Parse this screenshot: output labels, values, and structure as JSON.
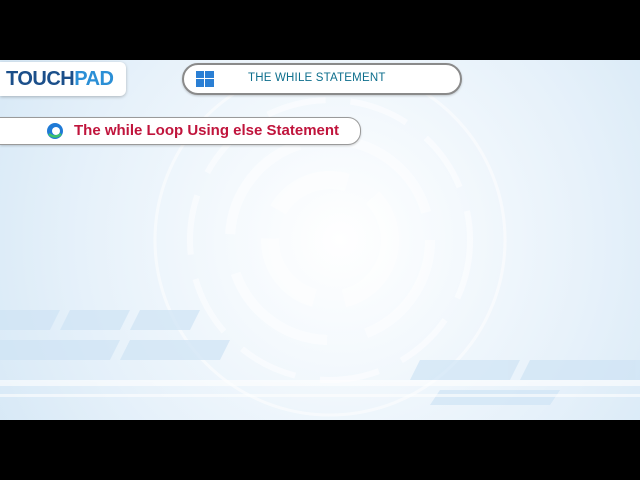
{
  "brand": {
    "logo_part1": "TOUCH",
    "logo_part2": "PAD"
  },
  "header": {
    "title": "THE WHILE STATEMENT",
    "icon": "windows-icon"
  },
  "subheader": {
    "title": "The while Loop Using else Statement",
    "icon": "edge-browser-icon"
  },
  "colors": {
    "title_color": "#0d6e8c",
    "subtitle_color": "#c0143c",
    "logo_dark": "#1b4f8a",
    "logo_light": "#2b8fd6"
  }
}
